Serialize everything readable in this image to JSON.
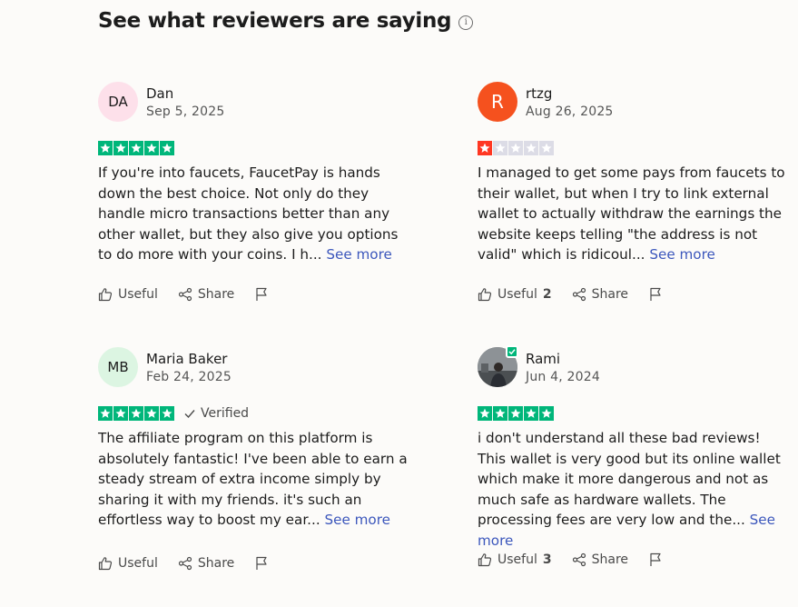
{
  "section": {
    "title": "See what reviewers are saying",
    "info_icon": "info-icon"
  },
  "colors": {
    "star_green": "#00b67a",
    "star_red": "#ff3722",
    "star_empty": "#dcdce6",
    "link_blue": "#3c57bc"
  },
  "reviews": [
    {
      "initials": "DA",
      "avatar_color": "#fde0ea",
      "name": "Dan",
      "date": "Sep 5, 2025",
      "rating": 5,
      "verified": "",
      "text": "If you're into faucets, FaucetPay is hands down the best choice. Not only do they handle micro transactions better than any other wallet, but they also give you options to do more with your coins. I h...",
      "see_more": "See more",
      "useful_label": "Useful",
      "useful_count": "",
      "share_label": "Share"
    },
    {
      "initials": "R",
      "avatar_color": "#f5511e",
      "name": "rtzg",
      "date": "Aug 26, 2025",
      "rating": 1,
      "verified": "",
      "text": "I managed to get some pays from faucets to their wallet, but when I try to link external wallet to actually withdraw the earnings the website keeps telling \"the address is not valid\" which is ridicoul...",
      "see_more": "See more",
      "useful_label": "Useful",
      "useful_count": "2",
      "share_label": "Share"
    },
    {
      "initials": "MB",
      "avatar_color": "#dcf5e2",
      "name": "Maria Baker",
      "date": "Feb 24, 2025",
      "rating": 5,
      "verified": "Verified",
      "text": "The affiliate program on this platform is absolutely fantastic! I've been able to earn a steady stream of extra income simply by sharing it with my friends. it's such an effortless way to boost my ear...",
      "see_more": "See more",
      "useful_label": "Useful",
      "useful_count": "",
      "share_label": "Share"
    },
    {
      "initials": "",
      "avatar_color": "",
      "name": "Rami",
      "date": "Jun 4, 2024",
      "rating": 5,
      "verified": "",
      "text": "i don't understand all these bad reviews! This wallet is very good but its online wallet which make it more dangerous and not as much safe as hardware wallets. The processing fees are very low and the...",
      "see_more": "See more",
      "useful_label": "Useful",
      "useful_count": "3",
      "share_label": "Share"
    }
  ]
}
